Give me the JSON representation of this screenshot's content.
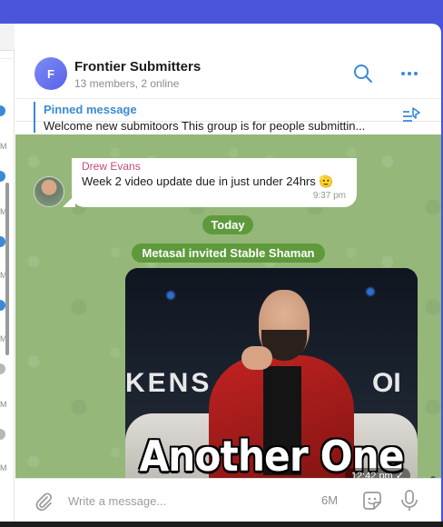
{
  "chat": {
    "avatar_letter": "F",
    "title": "Frontier Submitters",
    "subtitle": "13 members, 2 online"
  },
  "pinned": {
    "label": "Pinned message",
    "text": "Welcome new submitoors   This group is for people submittin..."
  },
  "left_panel": {
    "time_fragments": [
      "M",
      "M",
      "M",
      "M",
      "M",
      "M"
    ]
  },
  "messages": [
    {
      "sender": "Drew Evans",
      "text": "Week 2 video update due in just under 24hrs 🫡",
      "time": "9:37 pm"
    }
  ],
  "service": {
    "date_pill": "Today",
    "event": "Metasal invited  Stable Shaman"
  },
  "photo": {
    "caption": "Another One",
    "wall_text_left": "KENS",
    "wall_text_right": "OI",
    "time": "12:42 pm ✓"
  },
  "composer": {
    "placeholder": "Write a message...",
    "count": "6M"
  },
  "colors": {
    "accent": "#3a8ad6",
    "sender_name": "#c5487b",
    "pill": "#5e9a3c",
    "chat_bg": "#95b77a",
    "top_bar": "#4b55dc"
  },
  "icons": [
    "search-icon",
    "more-icon",
    "pin-list-icon",
    "attach-icon",
    "sticker-icon",
    "mic-icon"
  ]
}
